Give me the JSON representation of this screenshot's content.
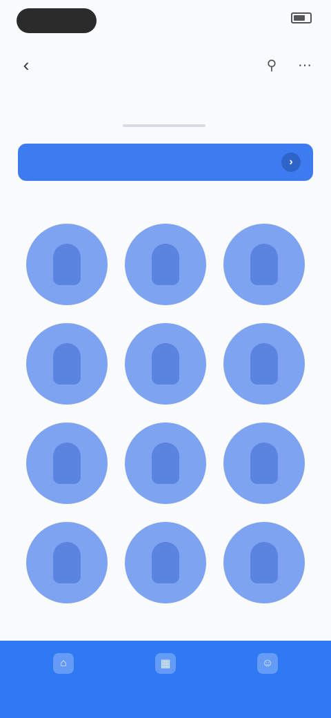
{
  "status": {
    "time": "",
    "signal": "",
    "battery_icon": "battery-icon"
  },
  "header": {
    "title": "",
    "back_icon": "chevron-left-icon",
    "action_icons": [
      "search-icon",
      "more-icon"
    ]
  },
  "tabs": [
    {
      "label": ""
    },
    {
      "label": ""
    }
  ],
  "banner": {
    "text": "",
    "arrow_icon": "arrow-right-icon"
  },
  "section": {
    "label": ""
  },
  "grid": {
    "items": [
      {
        "caption": ""
      },
      {
        "caption": ""
      },
      {
        "caption": ""
      },
      {
        "caption": ""
      },
      {
        "caption": ""
      },
      {
        "caption": ""
      },
      {
        "caption": ""
      },
      {
        "caption": ""
      },
      {
        "caption": ""
      },
      {
        "caption": ""
      },
      {
        "caption": ""
      },
      {
        "caption": ""
      }
    ]
  },
  "bottom_nav": [
    {
      "icon": "home-icon",
      "label": ""
    },
    {
      "icon": "grid-icon",
      "label": ""
    },
    {
      "icon": "user-icon",
      "label": ""
    }
  ],
  "colors": {
    "accent": "#3d7cf0",
    "nav": "#2f7af3",
    "tile": "#7ea3f1"
  }
}
